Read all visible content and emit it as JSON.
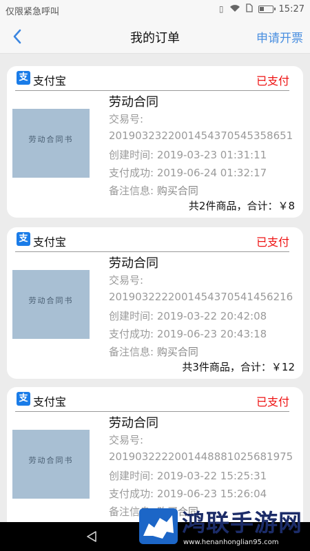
{
  "status_bar": {
    "carrier": "仅限紧急呼叫",
    "time": "15:27",
    "icons": [
      "vibrate-icon",
      "wifi-icon",
      "sim-icon",
      "battery-icon"
    ]
  },
  "nav": {
    "back_icon": "chevron-left-icon",
    "title": "我的订单",
    "action": "申请开票",
    "action_color": "#4a8fe0"
  },
  "orders": [
    {
      "pay_method": "支付宝",
      "status": "已支付",
      "product": "劳动合同",
      "trade_label": "交易号:",
      "trade_no": "2019032322001454370545358651",
      "created_label": "创建时间:",
      "created": "2019-03-23 01:31:11",
      "paid_label": "支付成功:",
      "paid": "2019-06-24 01:32:17",
      "note_label": "备注信息:",
      "note": "购买合同",
      "summary": "共2件商品，合计：￥8"
    },
    {
      "pay_method": "支付宝",
      "status": "已支付",
      "product": "劳动合同",
      "trade_label": "交易号:",
      "trade_no": "2019032222001454370541456216",
      "created_label": "创建时间:",
      "created": "2019-03-22 20:42:08",
      "paid_label": "支付成功:",
      "paid": "2019-06-23 20:43:18",
      "note_label": "备注信息:",
      "note": "购买合同",
      "summary": "共3件商品，合计：￥12"
    },
    {
      "pay_method": "支付宝",
      "status": "已支付",
      "product": "劳动合同",
      "trade_label": "交易号:",
      "trade_no": "2019032222001448881025681975",
      "created_label": "创建时间:",
      "created": "2019-03-22 15:25:31",
      "paid_label": "支付成功:",
      "paid": "2019-06-23 15:26:04",
      "note_label": "备注信息:",
      "note": "购买合同",
      "summary": ""
    }
  ],
  "thumbnail": {
    "title": "劳动合同书"
  },
  "colors": {
    "status_paid": "#e11111",
    "alipay_blue": "#1a7ce8"
  },
  "watermark": {
    "text": "鸿联手游网",
    "url": "www.henanhonglian95.com"
  }
}
